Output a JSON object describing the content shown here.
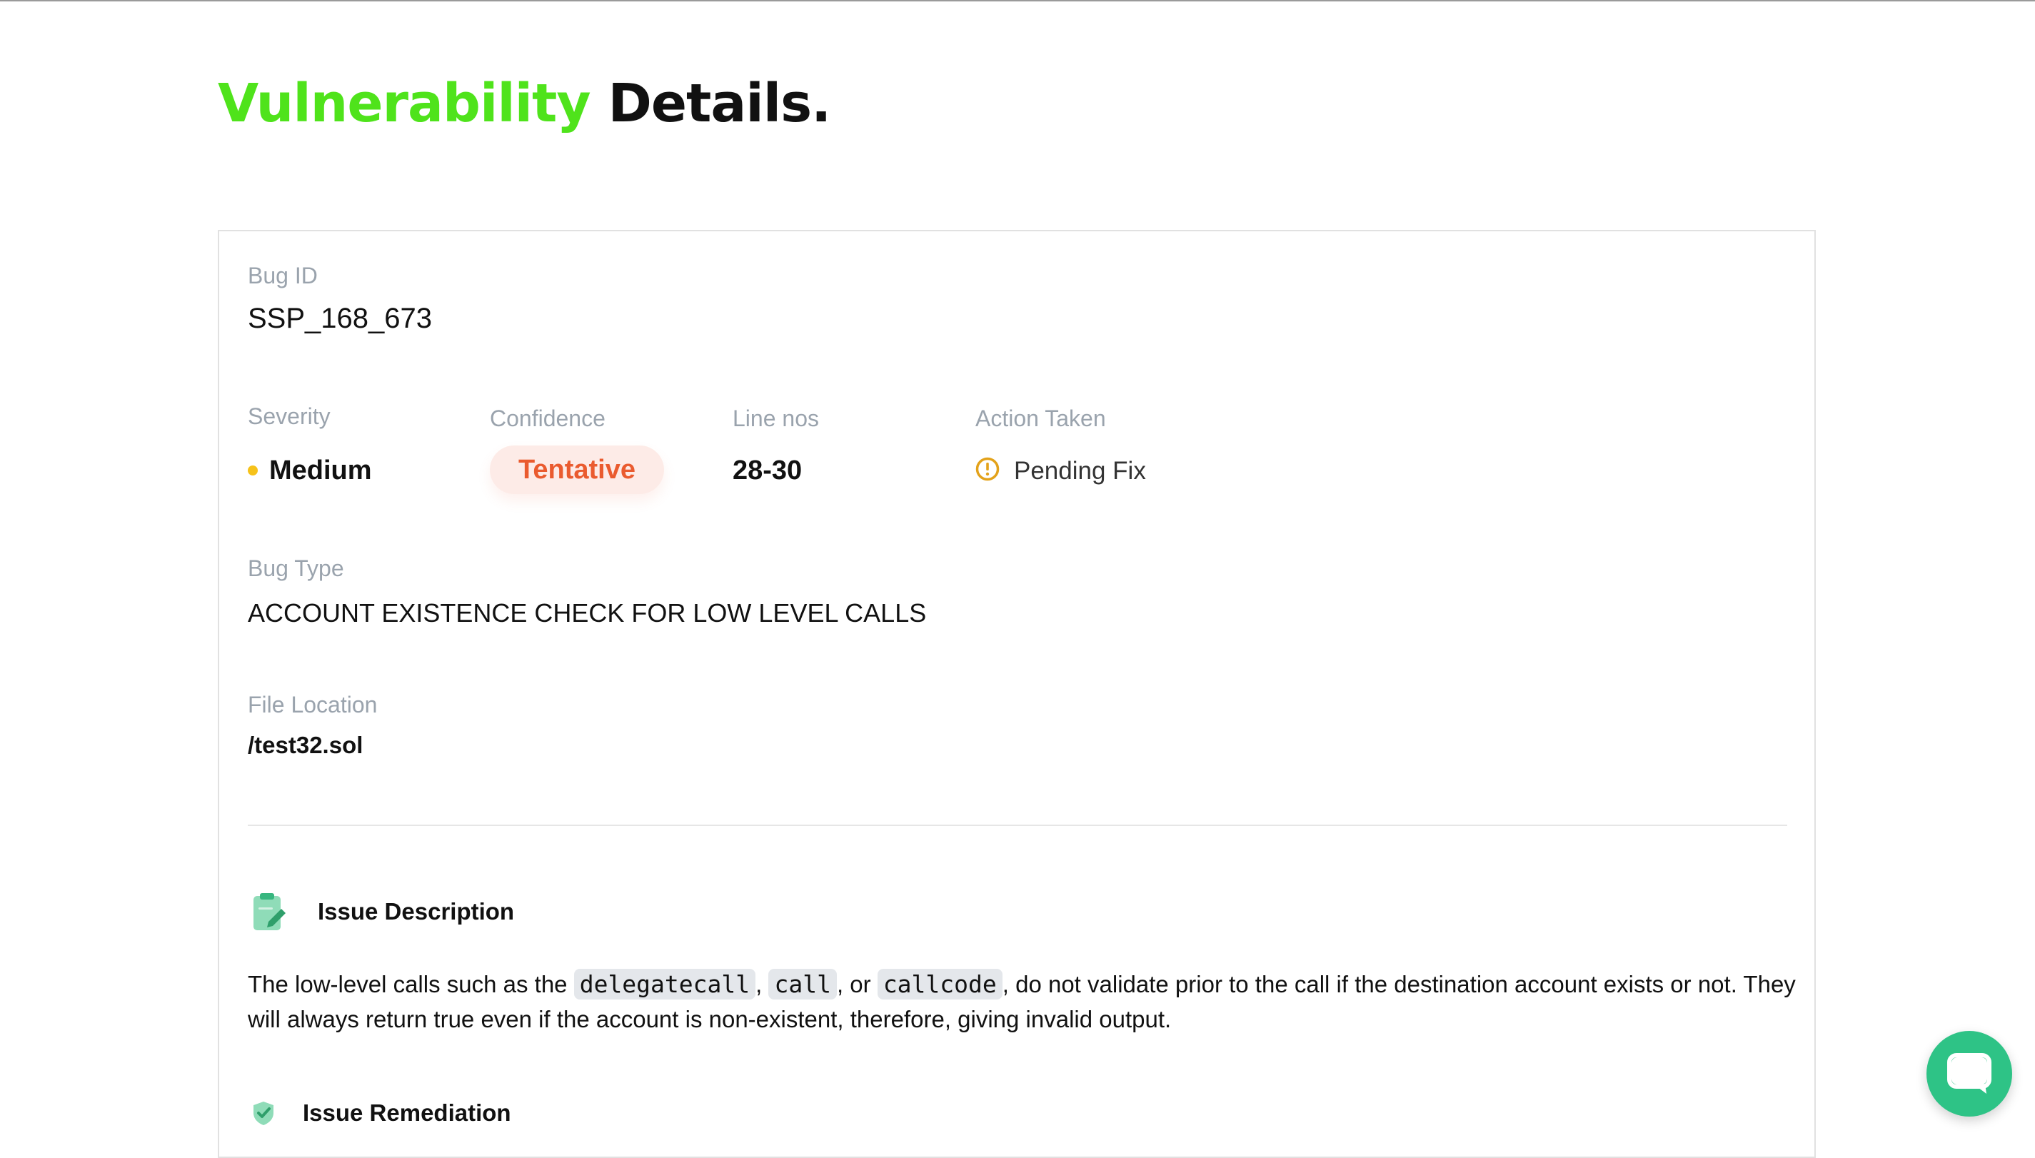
{
  "page": {
    "title_highlight": "Vulnerability",
    "title_rest": "Details."
  },
  "bug": {
    "id_label": "Bug ID",
    "id": "SSP_168_673",
    "severity_label": "Severity",
    "severity": "Medium",
    "confidence_label": "Confidence",
    "confidence": "Tentative",
    "line_label": "Line nos",
    "lines": "28-30",
    "action_label": "Action Taken",
    "action": "Pending Fix",
    "type_label": "Bug Type",
    "type": "ACCOUNT EXISTENCE CHECK FOR LOW LEVEL CALLS",
    "file_label": "File Location",
    "file": "/test32.sol"
  },
  "issue_description": {
    "heading": "Issue Description",
    "text_1": "The low-level calls such as the ",
    "code_1": "delegatecall",
    "sep_1": ", ",
    "code_2": "call",
    "sep_2": ", or ",
    "code_3": "callcode",
    "text_2": ", do not validate prior to the call if the destination account exists or not. They will always return true even if the account is non-existent, therefore, giving invalid output."
  },
  "issue_remediation": {
    "heading": "Issue Remediation"
  },
  "colors": {
    "accent_green": "#4fe31b",
    "severity_medium": "#f6c21a",
    "confidence_tentative": "#ea5b2f",
    "pending_icon": "#e3a21a",
    "chat_button": "#2ec386"
  },
  "icons": {
    "severity": "dot-icon",
    "action": "alert-circle-icon",
    "description": "clipboard-edit-icon",
    "remediation": "shield-check-icon",
    "chat": "chat-bubble-icon"
  }
}
